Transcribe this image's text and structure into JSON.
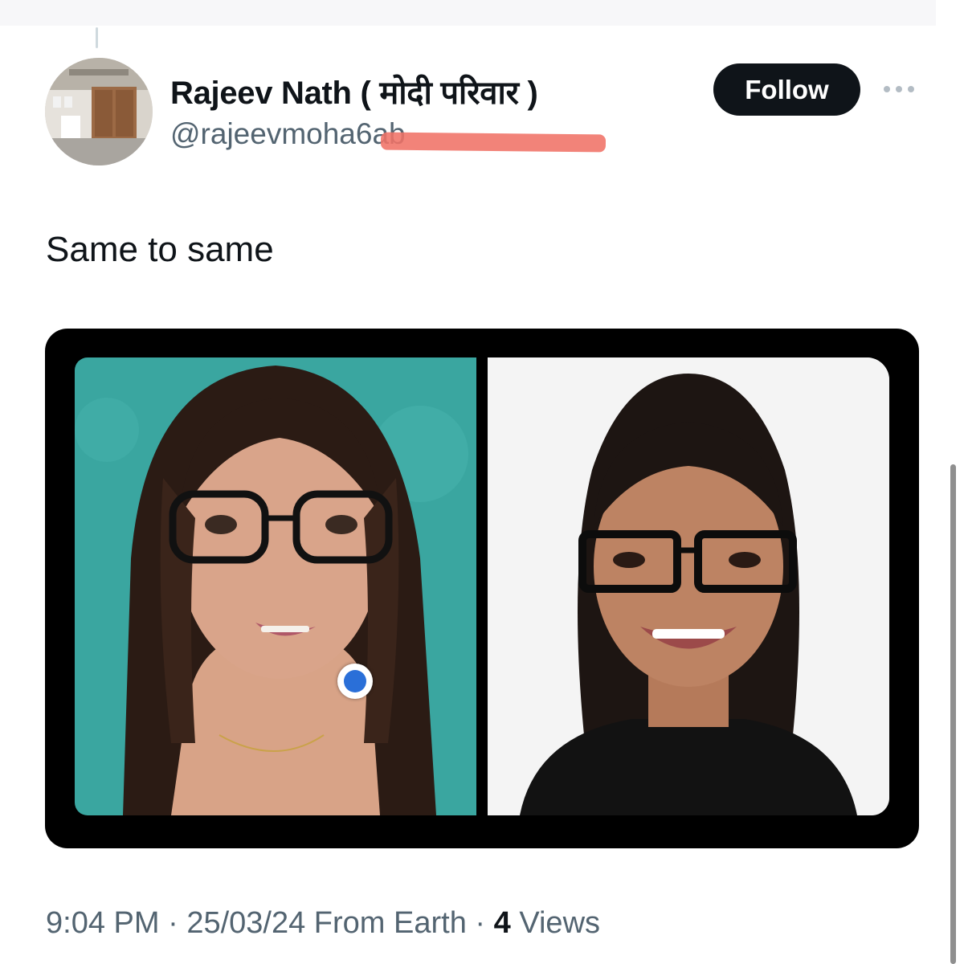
{
  "tweet": {
    "author": {
      "display_name": "Rajeev Nath ( मोदी परिवार )",
      "handle": "@rajeevmoha6ab"
    },
    "follow_label": "Follow",
    "more_icon": "more-horizontal-icon",
    "text": "Same to same",
    "meta": {
      "time": "9:04 PM",
      "separator": "·",
      "date": "25/03/24",
      "source": "From Earth",
      "views_count": "4",
      "views_label": "Views"
    }
  },
  "colors": {
    "text_primary": "#0f1419",
    "text_secondary": "#536471",
    "follow_bg": "#0f1419",
    "follow_fg": "#ffffff",
    "redaction": "#f07266",
    "marker_blue": "#2a6fd8",
    "left_photo_bg": "#3aa6a0",
    "right_photo_bg": "#f4f4f4"
  }
}
